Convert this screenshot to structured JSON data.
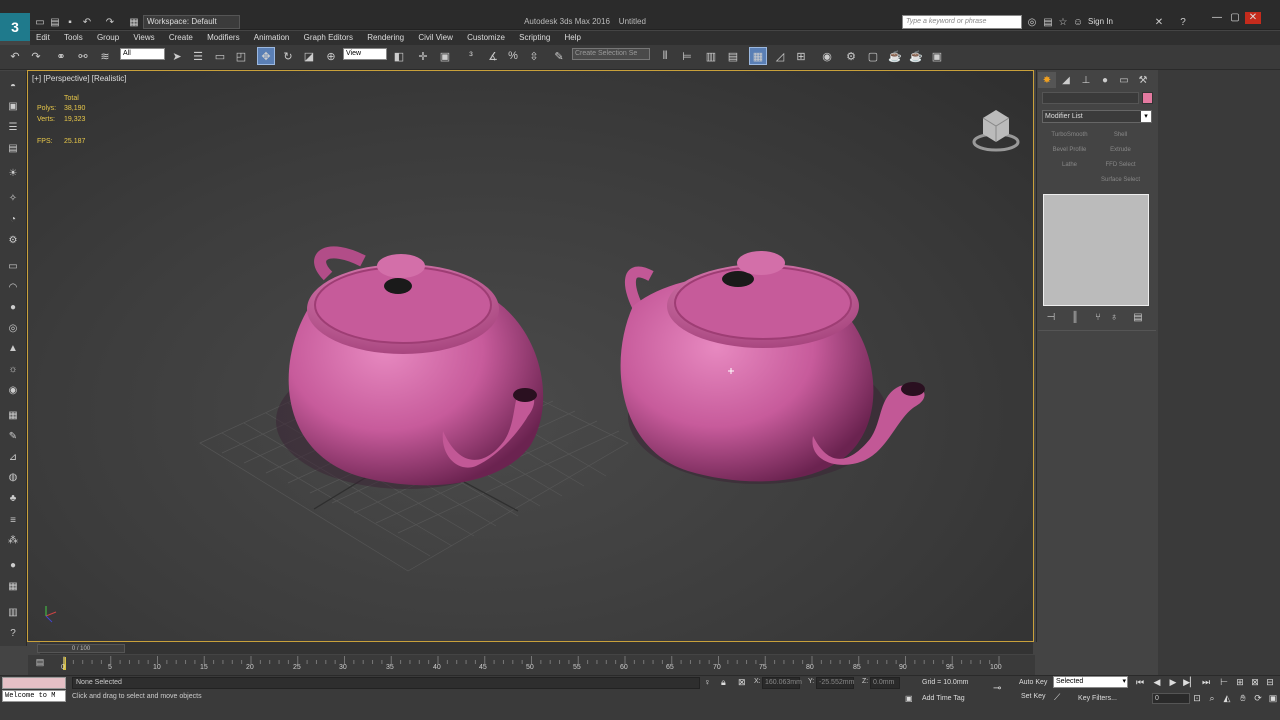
{
  "app": {
    "workspace": "Workspace: Default",
    "title": "Autodesk 3ds Max 2016",
    "document": "Untitled",
    "search_placeholder": "Type a keyword or phrase",
    "sign_in": "Sign In"
  },
  "menu": [
    "Edit",
    "Tools",
    "Group",
    "Views",
    "Create",
    "Modifiers",
    "Animation",
    "Graph Editors",
    "Rendering",
    "Civil View",
    "Customize",
    "Scripting",
    "Help"
  ],
  "toolbar": {
    "selection_filter": "All",
    "ref_coord": "View",
    "create_selection_set": "Create Selection Se"
  },
  "viewport": {
    "label": "[+] [Perspective] [Realistic]",
    "stats": {
      "header": "Total",
      "polys_label": "Polys:",
      "polys": "38,190",
      "verts_label": "Verts:",
      "verts": "19,323",
      "fps_label": "FPS:",
      "fps": "25.187"
    },
    "object_color": "#c75b9b"
  },
  "command_panel": {
    "object_color": "#e47aa0",
    "modifier_list": "Modifier List",
    "modifier_buttons": [
      "TurboSmooth",
      "Shell",
      "Bevel Profile",
      "Extrude",
      "Lathe",
      "FFD Select",
      "",
      "Surface Select"
    ]
  },
  "timeline": {
    "slider": "0 / 100",
    "ticks": [
      "0",
      "5",
      "10",
      "15",
      "20",
      "25",
      "30",
      "35",
      "40",
      "45",
      "50",
      "55",
      "60",
      "65",
      "70",
      "75",
      "80",
      "85",
      "90",
      "95",
      "100"
    ]
  },
  "status": {
    "maxscript_welcome": "Welcome to M",
    "selection": "None Selected",
    "prompt": "Click and drag to select and move objects",
    "x_label": "X:",
    "x": "160.063mm",
    "y_label": "Y:",
    "y": "-25.552mm",
    "z_label": "Z:",
    "z": "0.0mm",
    "grid": "Grid = 10.0mm",
    "add_time_tag": "Add Time Tag",
    "auto_key": "Auto Key",
    "set_key": "Set Key",
    "selected": "Selected",
    "key_filters": "Key Filters...",
    "frame": "0"
  }
}
